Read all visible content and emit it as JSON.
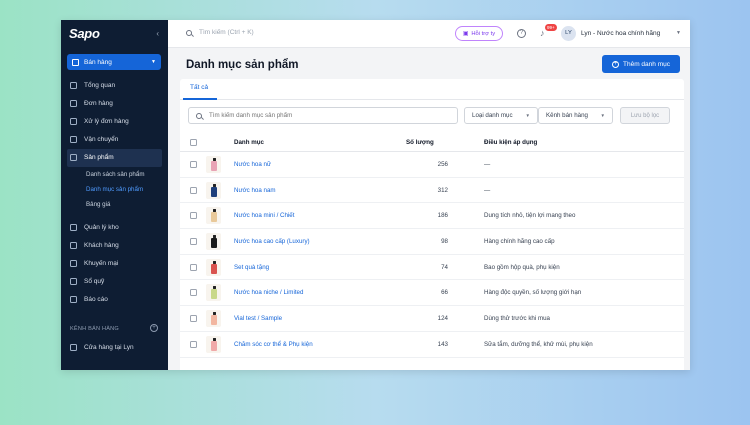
{
  "sidebar": {
    "logo": "Sapo",
    "sales_channel_button": "Bán hàng",
    "nav": [
      {
        "label": "Tổng quan",
        "icon": "dashboard-icon"
      },
      {
        "label": "Đơn hàng",
        "icon": "order-icon"
      },
      {
        "label": "Xử lý đơn hàng",
        "icon": "process-order-icon"
      },
      {
        "label": "Vận chuyển",
        "icon": "truck-icon"
      },
      {
        "label": "Sản phẩm",
        "icon": "product-icon",
        "active": true
      }
    ],
    "product_sub": [
      {
        "label": "Danh sách sản phẩm"
      },
      {
        "label": "Danh mục sản phẩm",
        "active": true
      },
      {
        "label": "Bảng giá"
      }
    ],
    "nav2": [
      {
        "label": "Quản lý kho",
        "icon": "warehouse-icon"
      },
      {
        "label": "Khách hàng",
        "icon": "customer-icon"
      },
      {
        "label": "Khuyến mại",
        "icon": "promotion-icon"
      },
      {
        "label": "Sổ quỹ",
        "icon": "cashbook-icon"
      },
      {
        "label": "Báo cáo",
        "icon": "report-icon"
      }
    ],
    "channel_label": "KÊNH BÁN HÀNG",
    "store_label": "Cửa hàng tại Lyn"
  },
  "topbar": {
    "search_placeholder": "Tìm kiếm (Ctrl + K)",
    "support_label": "Hỗi trợ ty",
    "notif_count": "99+",
    "avatar_initials": "LY",
    "user_name": "Lyn - Nước hoa chính hãng"
  },
  "page": {
    "title": "Danh mục sản phẩm",
    "add_button": "Thêm danh mục",
    "tab_all": "Tất cả",
    "filter_placeholder": "Tìm kiếm danh mục sản phẩm",
    "filter_category_type": "Loại danh mục",
    "filter_sales_channel": "Kênh bán hàng",
    "save_filter": "Lưu bộ lọc"
  },
  "table": {
    "headers": {
      "category": "Danh mục",
      "quantity": "Số lượng",
      "condition": "Điều kiện áp dụng"
    },
    "rows": [
      {
        "name": "Nước hoa nữ",
        "qty": "256",
        "cond": "—",
        "color": "#e8a3b5"
      },
      {
        "name": "Nước hoa nam",
        "qty": "312",
        "cond": "—",
        "color": "#1f3f7a"
      },
      {
        "name": "Nước hoa mini / Chiết",
        "qty": "186",
        "cond": "Dung tích nhỏ, tiện lợi mang theo",
        "color": "#e9c99a"
      },
      {
        "name": "Nước hoa cao cấp (Luxury)",
        "qty": "98",
        "cond": "Hàng chính hãng cao cấp",
        "color": "#1a1a1a"
      },
      {
        "name": "Set quà tặng",
        "qty": "74",
        "cond": "Bao gồm hộp quà, phụ kiện",
        "color": "#d9534f"
      },
      {
        "name": "Nước hoa niche / Limited",
        "qty": "66",
        "cond": "Hàng độc quyền, số lượng giới hạn",
        "color": "#c9d88a"
      },
      {
        "name": "Vial test / Sample",
        "qty": "124",
        "cond": "Dùng thử trước khi mua",
        "color": "#f2b6a0"
      },
      {
        "name": "Chăm sóc cơ thể & Phụ kiện",
        "qty": "143",
        "cond": "Sữa tắm, dưỡng thể, khử mùi, phụ kiện",
        "color": "#f0a9a9"
      }
    ]
  }
}
